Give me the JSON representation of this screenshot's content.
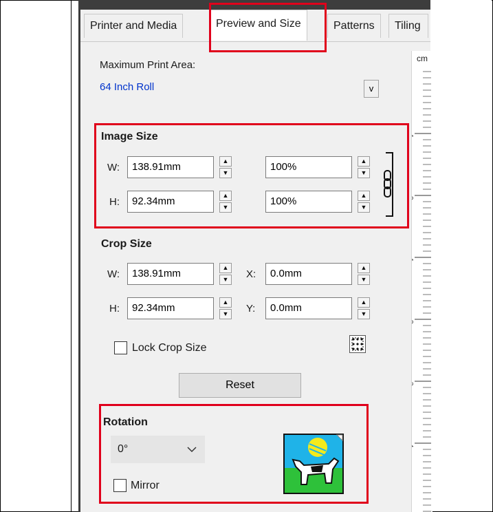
{
  "tabs": [
    {
      "label": "Printer and Media",
      "active": false
    },
    {
      "label": "Preview and Size",
      "active": true
    },
    {
      "label": "Patterns",
      "active": false
    },
    {
      "label": "Tiling",
      "active": false
    }
  ],
  "max_print_area": {
    "label": "Maximum Print Area:",
    "value": "64 Inch Roll",
    "dropdown_glyph": "v"
  },
  "image_size": {
    "heading": "Image Size",
    "w_label": "W:",
    "h_label": "H:",
    "width": "138.91mm",
    "height": "92.34mm",
    "width_pct": "100%",
    "height_pct": "100%"
  },
  "crop_size": {
    "heading": "Crop Size",
    "w_label": "W:",
    "h_label": "H:",
    "x_label": "X:",
    "y_label": "Y:",
    "width": "138.91mm",
    "height": "92.34mm",
    "x": "0.0mm",
    "y": "0.0mm",
    "lock_label": "Lock Crop Size",
    "lock_checked": false
  },
  "reset_label": "Reset",
  "rotation": {
    "heading": "Rotation",
    "value": "0°",
    "mirror_label": "Mirror",
    "mirror_checked": false
  },
  "ruler": {
    "unit": "cm",
    "marks": [
      "1",
      "0",
      "1",
      "2",
      "3",
      "4"
    ]
  },
  "colors": {
    "highlight": "#e0001b",
    "link_blue": "#0033cc",
    "panel_bg": "#f0f0f0"
  }
}
